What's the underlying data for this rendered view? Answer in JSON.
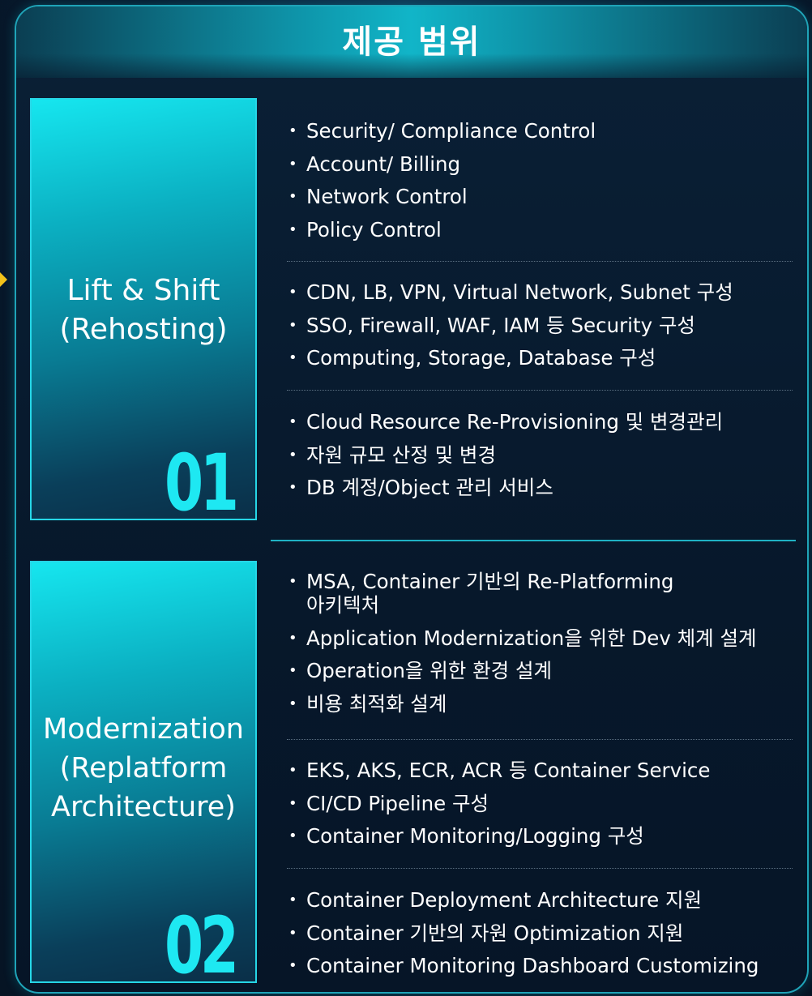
{
  "header": {
    "title": "제공 범위"
  },
  "sections": [
    {
      "card_title": "Lift & Shift\n(Rehosting)",
      "card_number": "01",
      "groups": [
        {
          "items": [
            "Security/ Compliance Control",
            "Account/ Billing",
            "Network Control",
            "Policy Control"
          ]
        },
        {
          "items": [
            "CDN, LB, VPN, Virtual Network, Subnet 구성",
            "SSO, Firewall, WAF, IAM 등 Security 구성",
            "Computing, Storage, Database 구성"
          ]
        },
        {
          "items": [
            "Cloud Resource Re-Provisioning 및 변경관리",
            "자원 규모 산정 및 변경",
            "DB 계정/Object 관리 서비스"
          ]
        }
      ]
    },
    {
      "card_title": "Modernization\n(Replatform\nArchitecture)",
      "card_number": "02",
      "groups": [
        {
          "items": [
            "MSA, Container 기반의 Re-Platforming\n아키텍처",
            "Application Modernization을 위한 Dev 체계 설계",
            "Operation을 위한 환경 설계",
            "비용 최적화 설계"
          ]
        },
        {
          "items": [
            "EKS, AKS, ECR, ACR 등 Container Service",
            "CI/CD Pipeline 구성",
            "Container Monitoring/Logging 구성"
          ]
        },
        {
          "items": [
            "Container Deployment Architecture 지원",
            "Container 기반의 자원 Optimization 지원",
            "Container Monitoring Dashboard Customizing"
          ]
        }
      ]
    }
  ]
}
